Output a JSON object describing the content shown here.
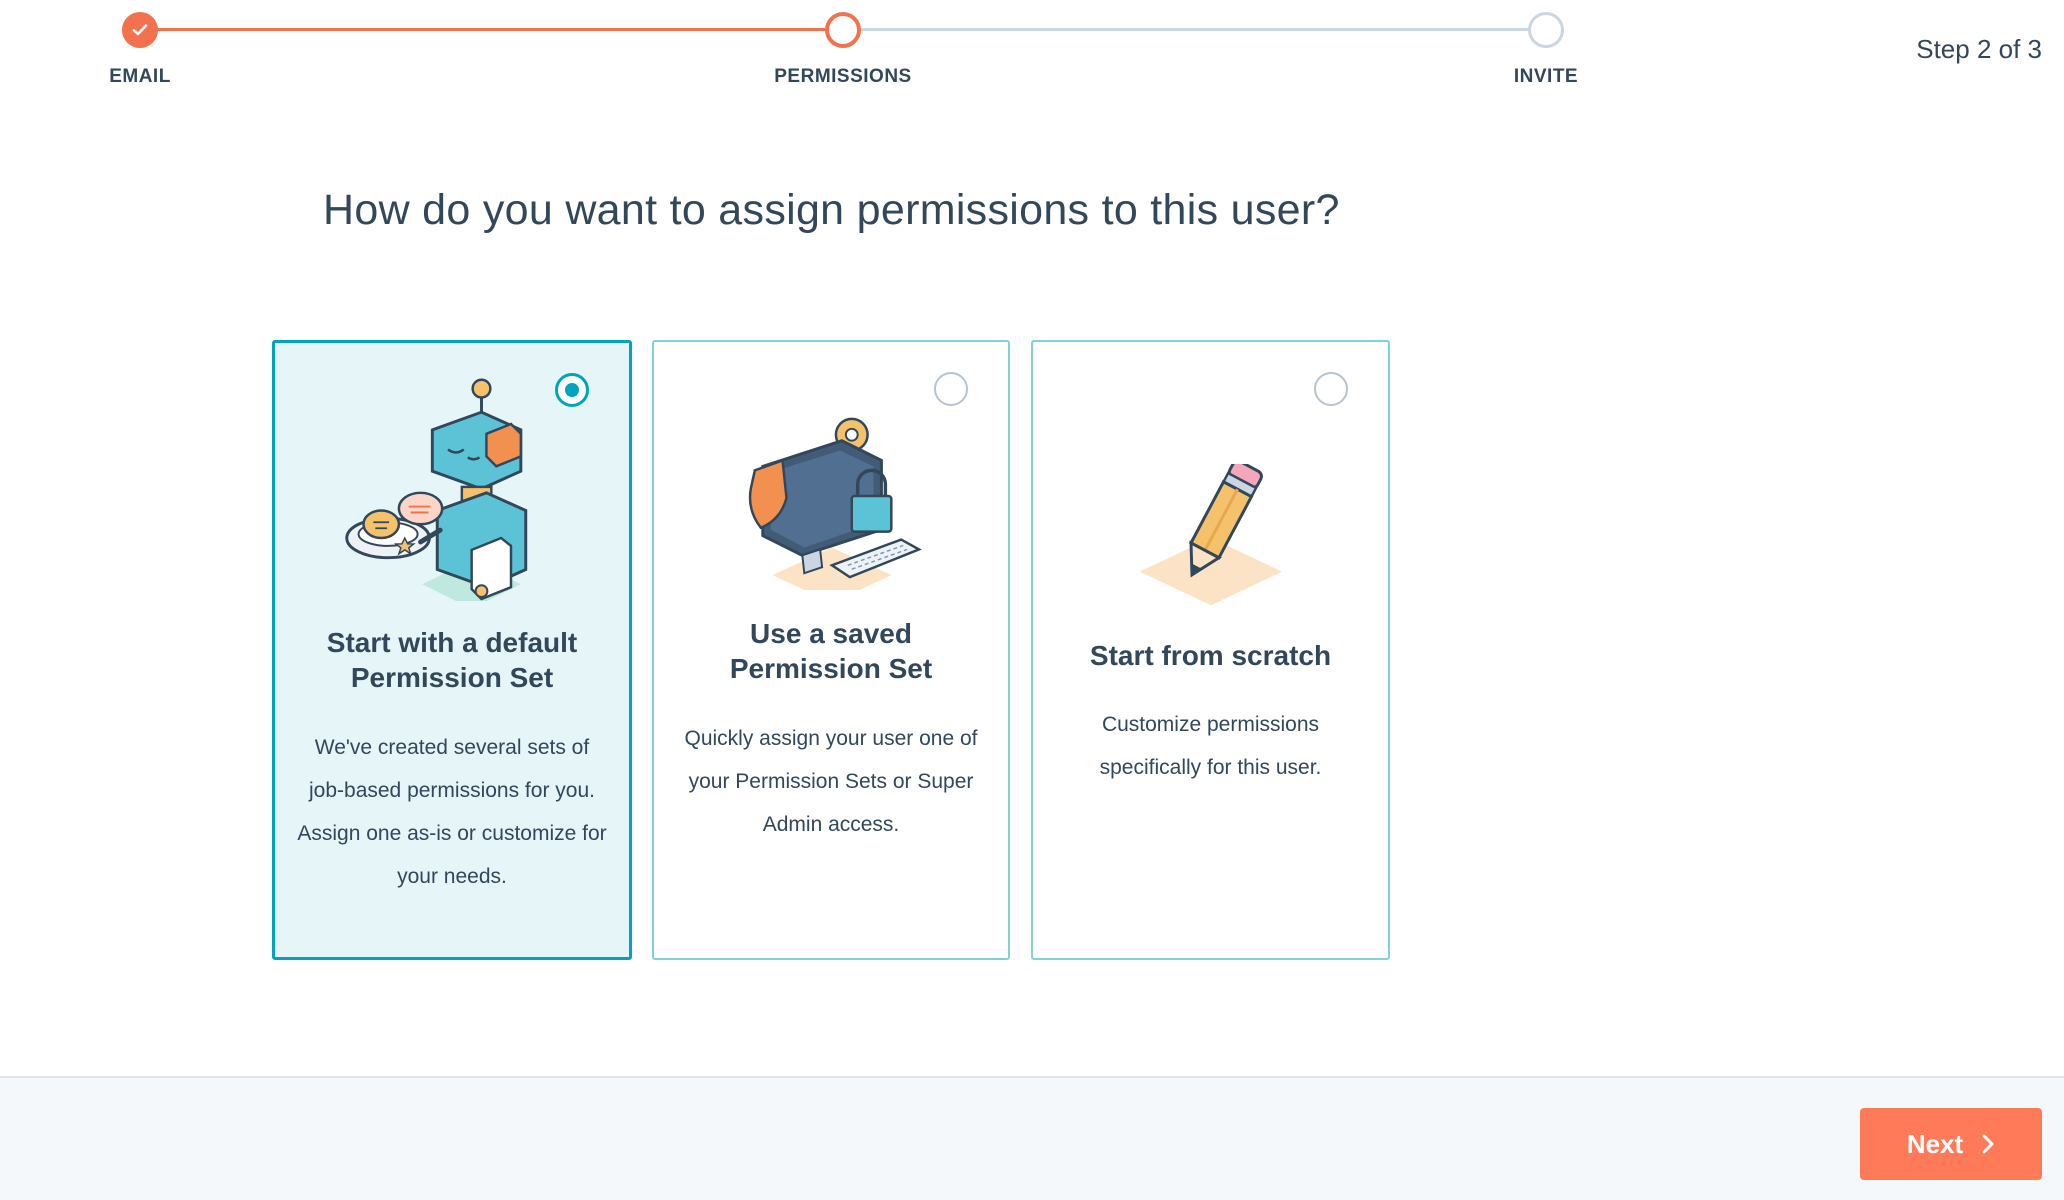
{
  "stepper": {
    "steps": [
      {
        "label": "EMAIL",
        "state": "complete"
      },
      {
        "label": "PERMISSIONS",
        "state": "current"
      },
      {
        "label": "INVITE",
        "state": "pending"
      }
    ],
    "step_count": "Step 2 of 3"
  },
  "main": {
    "heading": "How do you want to assign permissions to this user?",
    "options": [
      {
        "title": "Start with a default Permission Set",
        "description": "We've created several sets of job-based permissions for you. Assign one as-is or customize for your needs.",
        "selected": true,
        "icon": "robot-waiter-illustration"
      },
      {
        "title": "Use a saved Permission Set",
        "description": "Quickly assign your user one of your Permission Sets or Super Admin access.",
        "selected": false,
        "icon": "computer-lock-illustration"
      },
      {
        "title": "Start from scratch",
        "description": "Customize permissions specifically for this user.",
        "selected": false,
        "icon": "pencil-illustration"
      }
    ]
  },
  "footer": {
    "next_label": "Next"
  },
  "colors": {
    "accent": "#ff7a59",
    "progress": "#f2714f",
    "selected_border": "#00a4bd",
    "selected_bg": "#e5f5f8",
    "text": "#33475b"
  }
}
